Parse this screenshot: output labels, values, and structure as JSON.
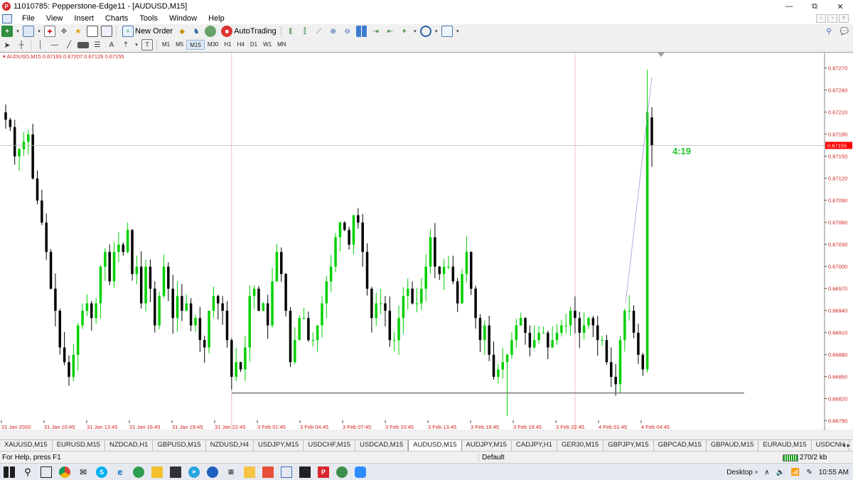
{
  "window": {
    "title": "11010785: Pepperstone-Edge11 - [AUDUSD,M15]",
    "controls": [
      "—",
      "⧉",
      "✕"
    ]
  },
  "menu": {
    "items": [
      "File",
      "View",
      "Insert",
      "Charts",
      "Tools",
      "Window",
      "Help"
    ],
    "mdi_controls": [
      "–",
      "▫",
      "×"
    ]
  },
  "toolbar": {
    "new_order_label": "New Order",
    "autotrading_label": "AutoTrading",
    "text_tool": "A",
    "label_tool": "T",
    "timeframes": [
      "M1",
      "M5",
      "M15",
      "M30",
      "H1",
      "H4",
      "D1",
      "W1",
      "MN"
    ],
    "active_timeframe": "M15"
  },
  "chart": {
    "header": "AUDUSD,M15  0.67193 0.67207 0.67126 0.67155",
    "countdown": "4:19",
    "current_price_label": "0.67155",
    "price_labels": [
      "0.67270",
      "0.67240",
      "0.67210",
      "0.67180",
      "0.67150",
      "0.67120",
      "0.67090",
      "0.67060",
      "0.67030",
      "0.67000",
      "0.66970",
      "0.66940",
      "0.66910",
      "0.66880",
      "0.66850",
      "0.66820",
      "0.66790"
    ],
    "time_labels": [
      "31 Jan 2020",
      "31 Jan 10:45",
      "31 Jan 13:45",
      "31 Jan 16:45",
      "31 Jan 19:45",
      "31 Jan 22:45",
      "3 Feb 01:45",
      "3 Feb 04:45",
      "3 Feb 07:45",
      "3 Feb 10:45",
      "3 Feb 13:45",
      "3 Feb 16:45",
      "3 Feb 19:45",
      "3 Feb 22:45",
      "4 Feb 01:45",
      "4 Feb 04:45"
    ],
    "colors": {
      "bull": "#00d000",
      "bear": "#000000",
      "price_marker": "#ff0000",
      "period_separator": "#e8a8a8",
      "countdown": "#22c22e",
      "header_text": "#d02020"
    }
  },
  "chart_data": {
    "type": "candlestick",
    "symbol": "AUDUSD",
    "timeframe": "M15",
    "ohlc_last": {
      "open": 0.67193,
      "high": 0.67207,
      "low": 0.67126,
      "close": 0.67155
    },
    "current_price": 0.67155,
    "ylim": [
      0.66777,
      0.67291
    ],
    "support_line": 0.66818,
    "closes": [
      0.6719,
      0.6718,
      0.6714,
      0.6715,
      0.6716,
      0.6717,
      0.6711,
      0.6708,
      0.6705,
      0.6701,
      0.6696,
      0.6693,
      0.6688,
      0.6686,
      0.6684,
      0.6687,
      0.6691,
      0.6693,
      0.6694,
      0.6692,
      0.6694,
      0.6699,
      0.6701,
      0.6697,
      0.6701,
      0.6702,
      0.6701,
      0.6704,
      0.6698,
      0.6699,
      0.6694,
      0.6699,
      0.6696,
      0.6691,
      0.6695,
      0.6699,
      0.6696,
      0.6692,
      0.6695,
      0.6693,
      0.6694,
      0.6691,
      0.6692,
      0.6689,
      0.6688,
      0.6693,
      0.6695,
      0.6694,
      0.6693,
      0.6689,
      0.6684,
      0.6686,
      0.6685,
      0.6688,
      0.6695,
      0.6696,
      0.6693,
      0.6694,
      0.6691,
      0.6697,
      0.6701,
      0.6698,
      0.6693,
      0.6686,
      0.6689,
      0.6692,
      0.6692,
      0.6689,
      0.6689,
      0.6691,
      0.6694,
      0.6697,
      0.6699,
      0.6703,
      0.6705,
      0.6704,
      0.6702,
      0.6706,
      0.6705,
      0.6701,
      0.6696,
      0.6692,
      0.6694,
      0.6694,
      0.6693,
      0.6689,
      0.6689,
      0.6692,
      0.6695,
      0.6696,
      0.6694,
      0.6694,
      0.6696,
      0.6699,
      0.6703,
      0.6699,
      0.6698,
      0.6699,
      0.6699,
      0.6697,
      0.6694,
      0.6698,
      0.6701,
      0.6696,
      0.6692,
      0.6689,
      0.6691,
      0.6687,
      0.6684,
      0.6685,
      0.6686,
      0.6687,
      0.6689,
      0.6691,
      0.6692,
      0.669,
      0.6688,
      0.6689,
      0.669,
      0.669,
      0.6688,
      0.6689,
      0.669,
      0.6691,
      0.6691,
      0.6693,
      0.6692,
      0.669,
      0.6691,
      0.6692,
      0.6691,
      0.6689,
      0.6689,
      0.6686,
      0.6684,
      0.6683,
      0.6689,
      0.6693,
      0.6693,
      0.669,
      0.6687,
      0.6685,
      0.672,
      0.67155
    ]
  },
  "tabs": {
    "items": [
      "XAUUSD,M15",
      "EURUSD,M15",
      "NZDCAD,H1",
      "GBPUSD,M15",
      "NZDUSD,H4",
      "USDJPY,M15",
      "USDCHF,M15",
      "USDCAD,M15",
      "AUDUSD,M15",
      "AUDJPY,M15",
      "CADJPY,H1",
      "GER30,M15",
      "GBPJPY,M15",
      "GBPCAD,M15",
      "GBPAUD,M15",
      "EURAUD,M15",
      "USDCNH"
    ],
    "active": "AUDUSD,M15",
    "arrows": "◂ ▸"
  },
  "status": {
    "help": "For Help, press F1",
    "profile": "Default",
    "traffic": "270/2 kb"
  },
  "taskbar": {
    "desktop_label": "Desktop",
    "chevron": "»",
    "time": "10:55 AM"
  }
}
